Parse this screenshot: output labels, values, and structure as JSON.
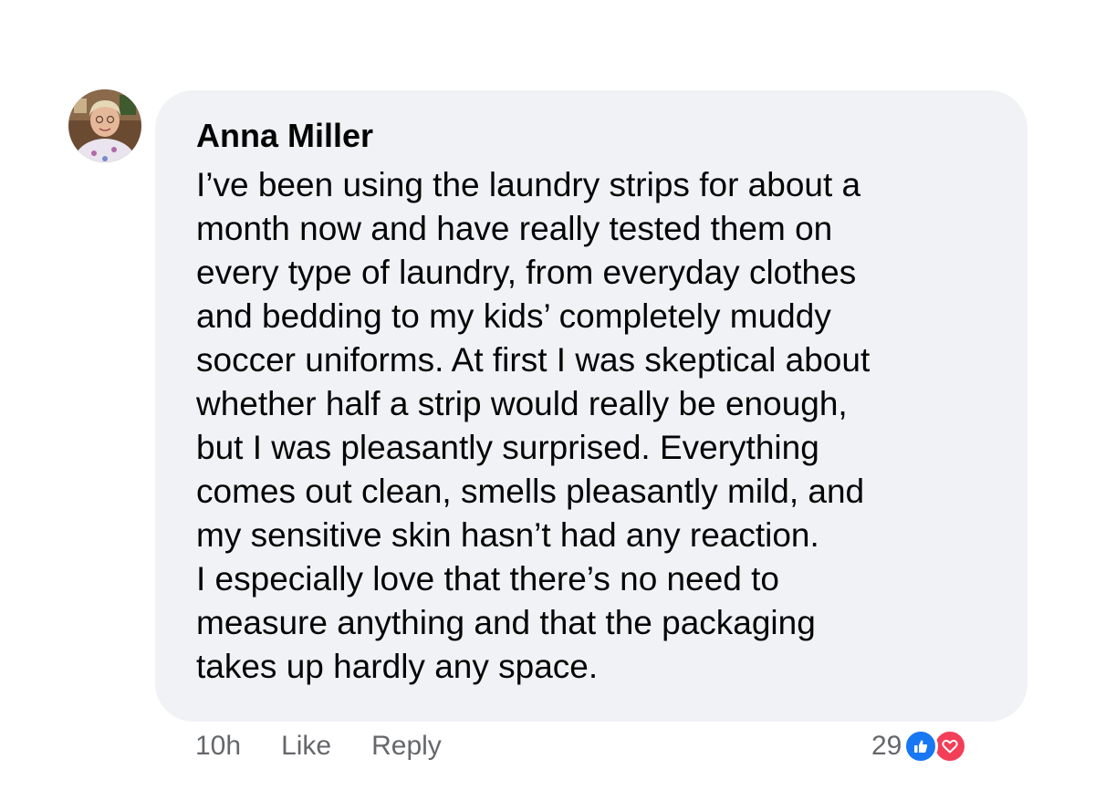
{
  "comment": {
    "author": "Anna Miller",
    "text_lines": [
      "I’ve been using the laundry strips for about a",
      "month now and have really tested them on",
      "every type of laundry, from everyday clothes",
      "and bedding to my kids’ completely muddy",
      "soccer uniforms. At first I was skeptical about",
      "whether half a strip would really be enough,",
      "but I was pleasantly surprised. Everything",
      "comes out clean, smells pleasantly mild, and",
      "my sensitive skin hasn’t had any reaction.",
      "I especially love that there’s no need to",
      "measure anything and that the packaging",
      "takes up hardly any space."
    ],
    "timestamp": "10h",
    "like_label": "Like",
    "reply_label": "Reply",
    "reaction_count": "29",
    "reactions": [
      "like-icon",
      "love-icon"
    ]
  },
  "colors": {
    "bubble": "#f0f2f5",
    "text": "#050505",
    "meta": "#65676b",
    "like_reaction": "#1877f2",
    "love_reaction": "#f33e58"
  }
}
